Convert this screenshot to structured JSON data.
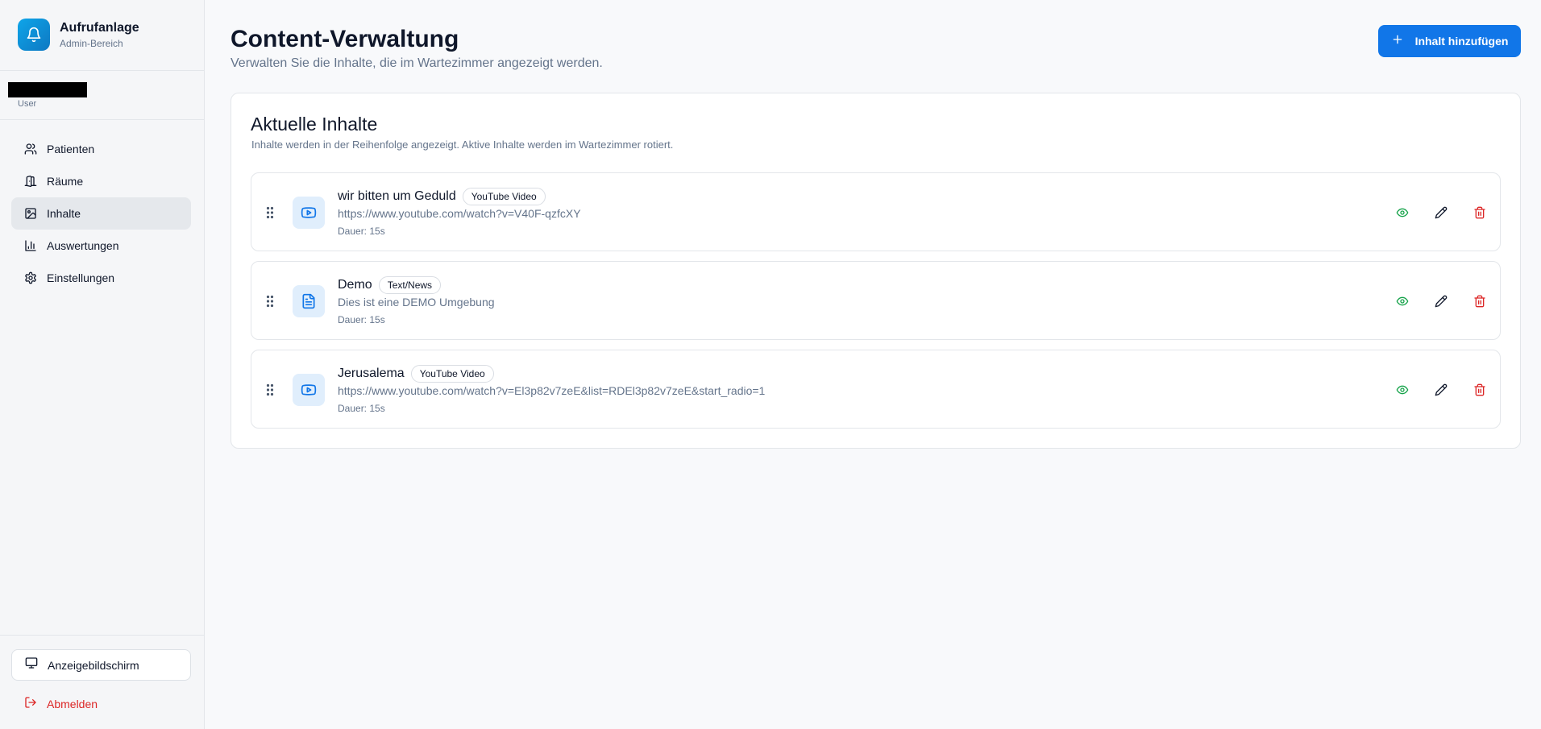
{
  "brand": {
    "title": "Aufrufanlage",
    "subtitle": "Admin-Bereich"
  },
  "user": {
    "role": "User"
  },
  "nav": [
    {
      "label": "Patienten",
      "icon": "users-icon",
      "active": false
    },
    {
      "label": "Räume",
      "icon": "door-icon",
      "active": false
    },
    {
      "label": "Inhalte",
      "icon": "image-icon",
      "active": true
    },
    {
      "label": "Auswertungen",
      "icon": "bar-chart-icon",
      "active": false
    },
    {
      "label": "Einstellungen",
      "icon": "gear-icon",
      "active": false
    }
  ],
  "sidebar_footer": {
    "display_label": "Anzeigebildschirm",
    "logout_label": "Abmelden"
  },
  "page": {
    "title": "Content-Verwaltung",
    "subtitle": "Verwalten Sie die Inhalte, die im Wartezimmer angezeigt werden.",
    "add_button": "Inhalt hinzufügen"
  },
  "card": {
    "title": "Aktuelle Inhalte",
    "subtitle": "Inhalte werden in der Reihenfolge angezeigt. Aktive Inhalte werden im Wartezimmer rotiert."
  },
  "items": [
    {
      "title": "wir bitten um Geduld",
      "badge": "YouTube Video",
      "description": "https://www.youtube.com/watch?v=V40F-qzfcXY",
      "duration": "Dauer: 15s",
      "icon": "youtube-icon"
    },
    {
      "title": "Demo",
      "badge": "Text/News",
      "description": "Dies ist eine DEMO Umgebung",
      "duration": "Dauer: 15s",
      "icon": "document-icon"
    },
    {
      "title": "Jerusalema",
      "badge": "YouTube Video",
      "description": "https://www.youtube.com/watch?v=El3p82v7zeE&list=RDEl3p82v7zeE&start_radio=1",
      "duration": "Dauer: 15s",
      "icon": "youtube-icon"
    }
  ],
  "colors": {
    "accent": "#1176e8",
    "danger": "#dc2626",
    "success": "#16a34a"
  }
}
